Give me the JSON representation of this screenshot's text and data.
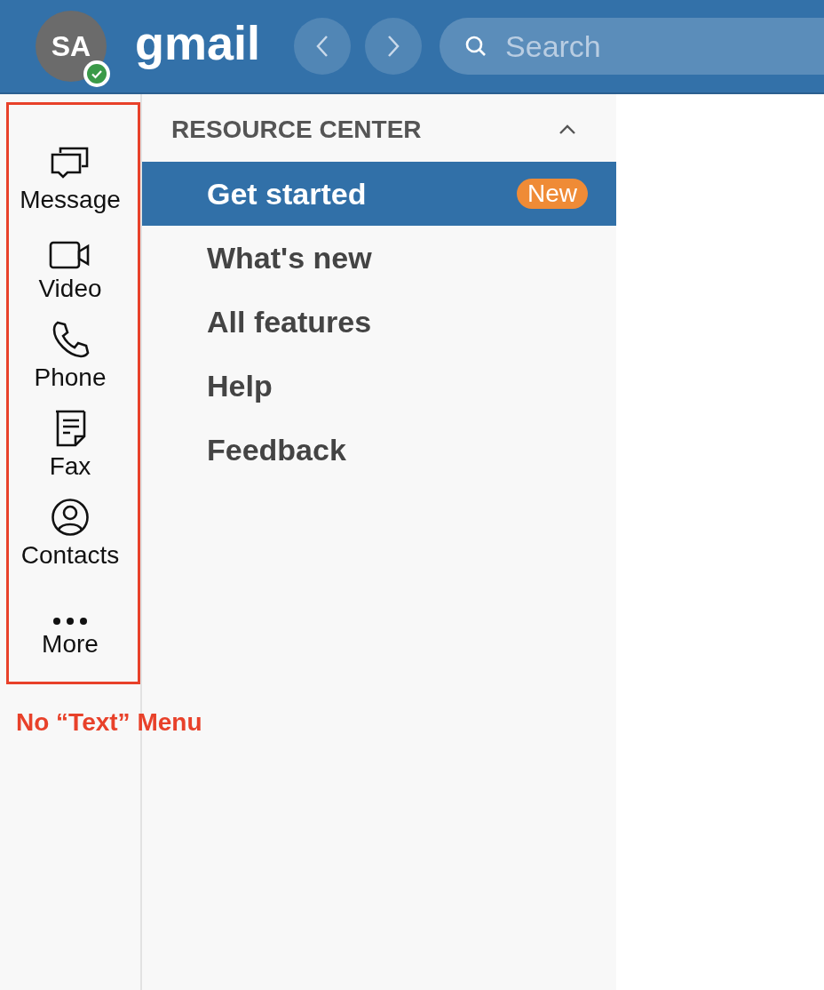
{
  "header": {
    "avatar": {
      "initials": "SA",
      "online": true
    },
    "title": "gmail",
    "search": {
      "placeholder": "Search"
    }
  },
  "nav_rail": {
    "items": [
      {
        "label": "Message"
      },
      {
        "label": "Video"
      },
      {
        "label": "Phone"
      },
      {
        "label": "Fax"
      },
      {
        "label": "Contacts"
      },
      {
        "label": "More"
      }
    ]
  },
  "resource_center": {
    "title": "RESOURCE CENTER",
    "expanded": true,
    "items": [
      {
        "label": "Get started",
        "selected": true,
        "badge": "New"
      },
      {
        "label": "What's new",
        "selected": false
      },
      {
        "label": "All features",
        "selected": false
      },
      {
        "label": "Help",
        "selected": false
      },
      {
        "label": "Feedback",
        "selected": false
      }
    ]
  },
  "annotation": {
    "text": "No “Text” Menu"
  }
}
